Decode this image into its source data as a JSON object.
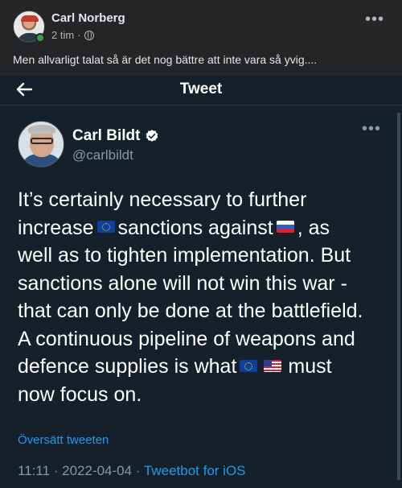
{
  "post": {
    "author": "Carl Norberg",
    "time": "2 tim",
    "separator": "·",
    "text": "Men allvarligt talat så är det nog bättre att inte vara så yvig....",
    "more": "•••"
  },
  "tweet": {
    "header_title": "Tweet",
    "author_name": "Carl Bildt",
    "handle": "@carlbildt",
    "more": "•••",
    "body": {
      "line1": "It’s certainly necessary to further",
      "line2a": "increase",
      "line2b": "sanctions against",
      "line2c": ", as",
      "line3": "well as to tighten implementation. But",
      "line4": "sanctions alone will not win this war -",
      "line5": "that can only be done at the battlefield.",
      "line6": "A continuous pipeline of weapons and",
      "line7a": "defence supplies is what",
      "line7b": "must",
      "line8": "now focus on."
    },
    "flags": [
      "eu-flag",
      "russia-flag",
      "eu-flag",
      "usa-flag"
    ],
    "translate_link": "Översätt tweeten",
    "timestamp": "11:11 · 2022-04-04 ·",
    "source": "Tweetbot for iOS"
  },
  "colors": {
    "facebook_bg": "#242526",
    "twitter_bg": "#15202b",
    "twitter_blue": "#1d9bf0",
    "muted": "#8899a6",
    "online": "#31a24c"
  }
}
